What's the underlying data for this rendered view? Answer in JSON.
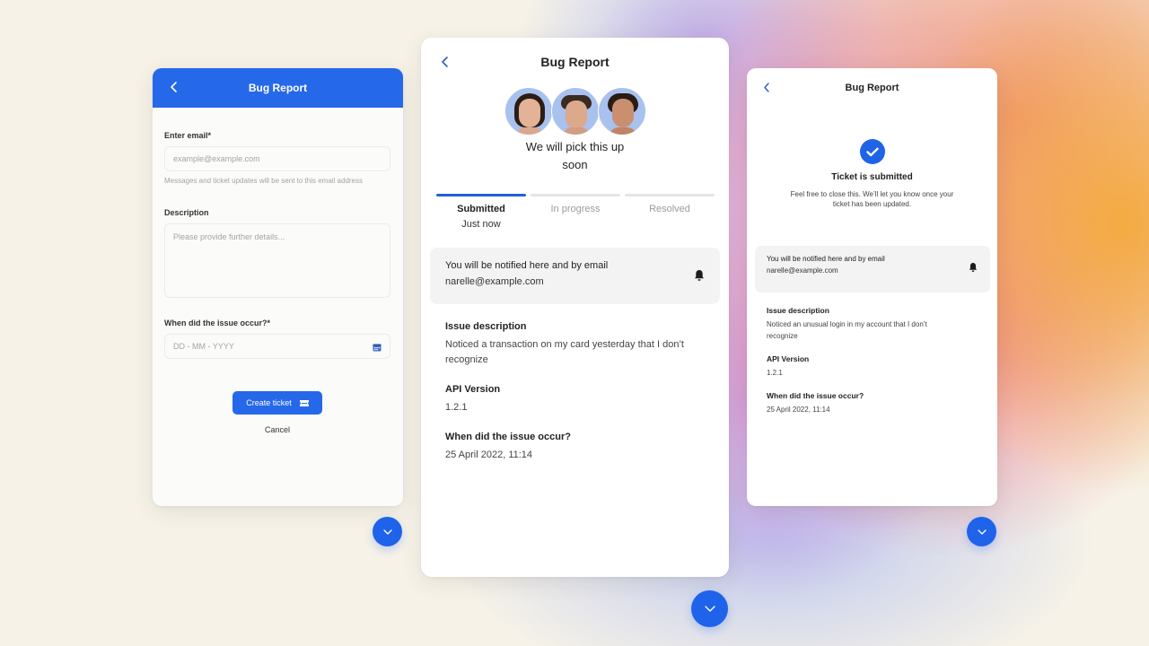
{
  "colors": {
    "accent": "#2668EA",
    "page_bg": "#F6F2E8"
  },
  "form_screen": {
    "title": "Bug Report",
    "email": {
      "label": "Enter email*",
      "placeholder": "example@example.com",
      "value": "",
      "help": "Messages and ticket updates will be sent to this email address"
    },
    "description": {
      "label": "Description",
      "placeholder": "Please provide further details...",
      "value": ""
    },
    "date": {
      "label": "When did the issue occur?*",
      "placeholder": "DD - MM - YYYY",
      "value": "",
      "icon": "calendar-icon"
    },
    "create_button": {
      "label": "Create ticket",
      "icon": "ticket-icon"
    },
    "cancel_label": "Cancel"
  },
  "status_screen": {
    "title": "Bug Report",
    "tagline": "We will pick this up soon",
    "avatars": [
      {
        "name": "support-agent-1"
      },
      {
        "name": "support-agent-2"
      },
      {
        "name": "support-agent-3"
      }
    ],
    "steps": [
      {
        "label": "Submitted",
        "sub": "Just now",
        "active": true
      },
      {
        "label": "In progress",
        "sub": "",
        "active": false
      },
      {
        "label": "Resolved",
        "sub": "",
        "active": false
      }
    ],
    "notify": {
      "title": "You will be notified here and by email",
      "email": "narelle@example.com",
      "icon": "bell-icon"
    },
    "fields": [
      {
        "key": "Issue description",
        "value": "Noticed a transaction on my card yesterday that I don’t recognize"
      },
      {
        "key": "API Version",
        "value": "1.2.1"
      },
      {
        "key": "When did the issue occur?",
        "value": "25 April 2022, 11:14"
      }
    ]
  },
  "confirm_screen": {
    "title": "Bug Report",
    "heading": "Ticket is submitted",
    "description": "Feel free to close this. We’ll let you know once your ticket has been updated.",
    "notify": {
      "title": "You will be notified here and by email",
      "email": "narelle@example.com",
      "icon": "bell-icon"
    },
    "fields": [
      {
        "key": "Issue description",
        "value": "Noticed an unusual login in my account that I don’t recognize"
      },
      {
        "key": "API Version",
        "value": "1.2.1"
      },
      {
        "key": "When did the issue occur?",
        "value": "25 April 2022, 11:14"
      }
    ]
  },
  "scroll_buttons": [
    {
      "icon": "chevron-down-icon"
    },
    {
      "icon": "chevron-down-icon"
    },
    {
      "icon": "chevron-down-icon"
    }
  ]
}
